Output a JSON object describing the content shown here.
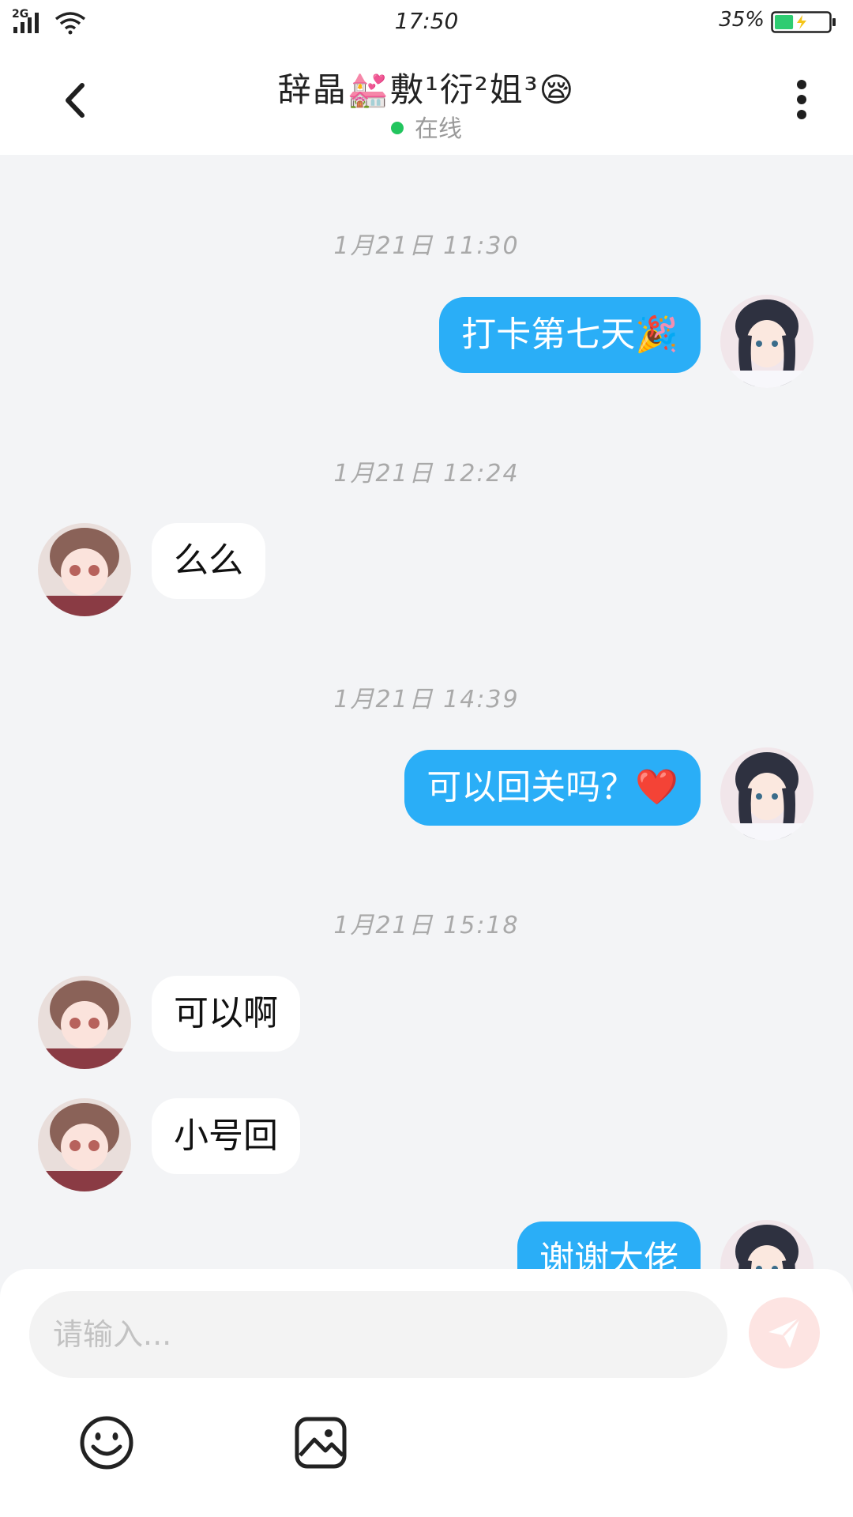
{
  "status_bar": {
    "network": "2G",
    "time": "17:50",
    "battery_percent": "35%",
    "battery_level": 0.35,
    "battery_color": "#2ecc71"
  },
  "header": {
    "title": "辞晶💒敷¹衍²姐³😪",
    "status": "在线",
    "status_color": "#22c55e",
    "back_icon": "chevron-left-icon",
    "more_icon": "vertical-dots-icon"
  },
  "messages": [
    {
      "type": "timestamp",
      "text": "1月21日 11:30"
    },
    {
      "type": "message",
      "from": "me",
      "text": "打卡第七天🎉"
    },
    {
      "type": "timestamp",
      "text": "1月21日 12:24"
    },
    {
      "type": "message",
      "from": "them",
      "text": "么么"
    },
    {
      "type": "timestamp",
      "text": "1月21日 14:39"
    },
    {
      "type": "message",
      "from": "me",
      "text": "可以回关吗？❤️"
    },
    {
      "type": "timestamp",
      "text": "1月21日 15:18"
    },
    {
      "type": "message",
      "from": "them",
      "text": "可以啊"
    },
    {
      "type": "message",
      "from": "them",
      "text": "小号回"
    },
    {
      "type": "message",
      "from": "me",
      "text": "谢谢大佬"
    }
  ],
  "composer": {
    "placeholder": "请输入...",
    "send_icon": "paper-plane-icon",
    "emoji_icon": "smiley-icon",
    "image_icon": "image-icon"
  },
  "colors": {
    "my_bubble": "#2aaef7",
    "their_bubble": "#ffffff",
    "background": "#f3f4f6"
  }
}
